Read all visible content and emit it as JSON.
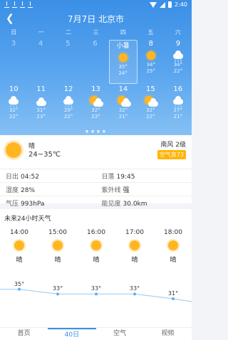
{
  "statusbar": {
    "time": "2:40"
  },
  "nav": {
    "title": "7月7日 北京市"
  },
  "weekdays": [
    "日",
    "一",
    "二",
    "三",
    "四",
    "五",
    "六"
  ],
  "week1": [
    {
      "day": "3",
      "past": true
    },
    {
      "day": "4",
      "past": true
    },
    {
      "day": "5",
      "past": true
    },
    {
      "day": "6",
      "past": true
    },
    {
      "day": "小暑",
      "today": true,
      "icon": "sun-icon",
      "hi": "35°",
      "lo": "24°"
    },
    {
      "day": "8",
      "icon": "sun-icon",
      "hi": "34°",
      "lo": "25°"
    },
    {
      "day": "9",
      "icon": "rain-icon",
      "hi": "34°",
      "lo": "22°"
    }
  ],
  "week2": [
    {
      "day": "10",
      "icon": "rain-icon",
      "hi": "32°",
      "lo": "22°"
    },
    {
      "day": "11",
      "icon": "cloud-icon",
      "hi": "31°",
      "lo": "23°"
    },
    {
      "day": "12",
      "icon": "rain-icon",
      "hi": "29°",
      "lo": "22°"
    },
    {
      "day": "13",
      "icon": "sun-cloud-icon",
      "hi": "32°",
      "lo": "23°"
    },
    {
      "day": "14",
      "icon": "sun-cloud-icon",
      "hi": "32°",
      "lo": "21°"
    },
    {
      "day": "15",
      "icon": "sun-cloud-icon",
      "hi": "32°",
      "lo": "22°"
    },
    {
      "day": "16",
      "icon": "rain-icon",
      "hi": "27°",
      "lo": "21°"
    }
  ],
  "today": {
    "condition": "晴",
    "range": "24~35℃",
    "wind": "南风 2级",
    "aqi": "空气良73",
    "rows": [
      [
        {
          "label": "日出",
          "value": "04:52"
        },
        {
          "label": "日落",
          "value": "19:45"
        }
      ],
      [
        {
          "label": "湿度",
          "value": "28%"
        },
        {
          "label": "紫外线",
          "value": "强"
        }
      ],
      [
        {
          "label": "气压",
          "value": "993hPa"
        },
        {
          "label": "能见度",
          "value": "30.0km"
        }
      ]
    ]
  },
  "hourly": {
    "title": "未来24小时天气",
    "hours": [
      {
        "time": "14:00",
        "cond": "晴",
        "temp": "35°"
      },
      {
        "time": "15:00",
        "cond": "晴",
        "temp": "33°"
      },
      {
        "time": "16:00",
        "cond": "晴",
        "temp": "33°"
      },
      {
        "time": "17:00",
        "cond": "晴",
        "temp": "33°"
      },
      {
        "time": "18:00",
        "cond": "晴",
        "temp": "31°"
      }
    ],
    "temps": [
      35,
      33,
      33,
      33,
      31
    ]
  },
  "tabs": [
    "首页",
    "40日",
    "空气",
    "视频"
  ],
  "active_tab": 1,
  "colors": {
    "accent": "#3a8fe6",
    "sun": "#ffb621",
    "aqi": "#ffb400"
  }
}
